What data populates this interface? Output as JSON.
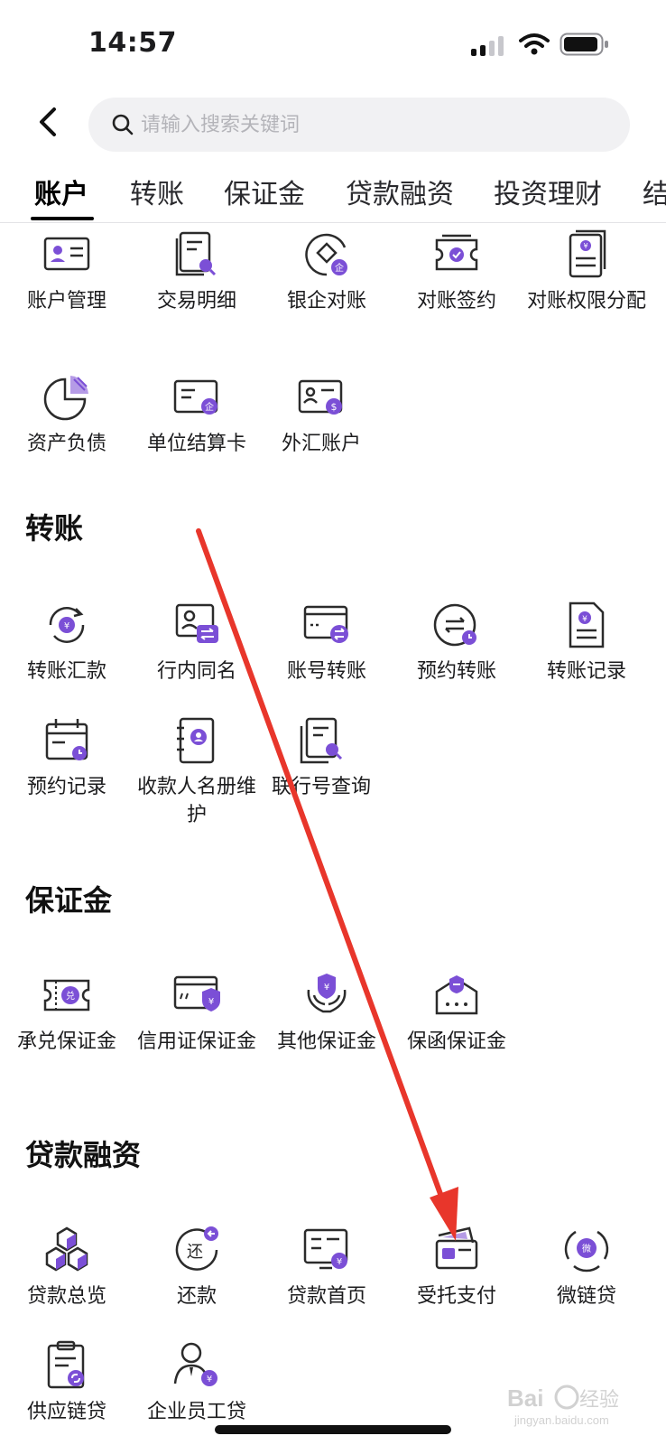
{
  "status_bar": {
    "time": "14:57"
  },
  "search": {
    "placeholder": "请输入搜索关键词",
    "value": ""
  },
  "tabs": [
    {
      "label": "账户",
      "active": true
    },
    {
      "label": "转账",
      "active": false
    },
    {
      "label": "保证金",
      "active": false
    },
    {
      "label": "贷款融资",
      "active": false
    },
    {
      "label": "投资理财",
      "active": false
    },
    {
      "label": "结",
      "active": false
    }
  ],
  "sections": {
    "account": {
      "items": [
        {
          "label": "账户管理",
          "icon": "account-card-icon"
        },
        {
          "label": "交易明细",
          "icon": "transaction-search-icon"
        },
        {
          "label": "银企对账",
          "icon": "bank-enterprise-reconcile-icon"
        },
        {
          "label": "对账签约",
          "icon": "reconcile-sign-icon"
        },
        {
          "label": "对账权限分配",
          "icon": "permission-document-icon"
        },
        {
          "label": "资产负债",
          "icon": "pie-chart-icon"
        },
        {
          "label": "单位结算卡",
          "icon": "enterprise-card-icon"
        },
        {
          "label": "外汇账户",
          "icon": "forex-account-icon"
        }
      ]
    },
    "transfer": {
      "title": "转账",
      "items": [
        {
          "label": "转账汇款",
          "icon": "transfer-cycle-icon"
        },
        {
          "label": "行内同名",
          "icon": "same-name-transfer-icon"
        },
        {
          "label": "账号转账",
          "icon": "account-transfer-icon"
        },
        {
          "label": "预约转账",
          "icon": "scheduled-transfer-icon"
        },
        {
          "label": "转账记录",
          "icon": "transfer-record-icon"
        },
        {
          "label": "预约记录",
          "icon": "calendar-clock-icon"
        },
        {
          "label": "收款人名册维护",
          "icon": "payee-book-icon"
        },
        {
          "label": "联行号查询",
          "icon": "bank-code-search-icon"
        }
      ]
    },
    "deposit": {
      "title": "保证金",
      "items": [
        {
          "label": "承兑保证金",
          "icon": "acceptance-ticket-icon"
        },
        {
          "label": "信用证保证金",
          "icon": "credit-card-shield-icon"
        },
        {
          "label": "其他保证金",
          "icon": "shield-hands-icon"
        },
        {
          "label": "保函保证金",
          "icon": "guarantee-envelope-icon"
        }
      ]
    },
    "loan": {
      "title": "贷款融资",
      "items": [
        {
          "label": "贷款总览",
          "icon": "cubes-icon"
        },
        {
          "label": "还款",
          "icon": "repay-icon"
        },
        {
          "label": "贷款首页",
          "icon": "loan-home-icon"
        },
        {
          "label": "受托支付",
          "icon": "entrusted-payment-icon"
        },
        {
          "label": "微链贷",
          "icon": "micro-chain-loan-icon"
        },
        {
          "label": "供应链贷",
          "icon": "supply-chain-icon"
        },
        {
          "label": "企业员工贷",
          "icon": "employee-loan-icon"
        }
      ]
    }
  },
  "watermark": {
    "text": "Baidu 经验",
    "subtext": "jingyan.baidu.com"
  },
  "colors": {
    "accent": "#7b4fd6",
    "annotation": "#e8362b",
    "text": "#1c1c1e",
    "search_bg": "#f1f1f3"
  }
}
